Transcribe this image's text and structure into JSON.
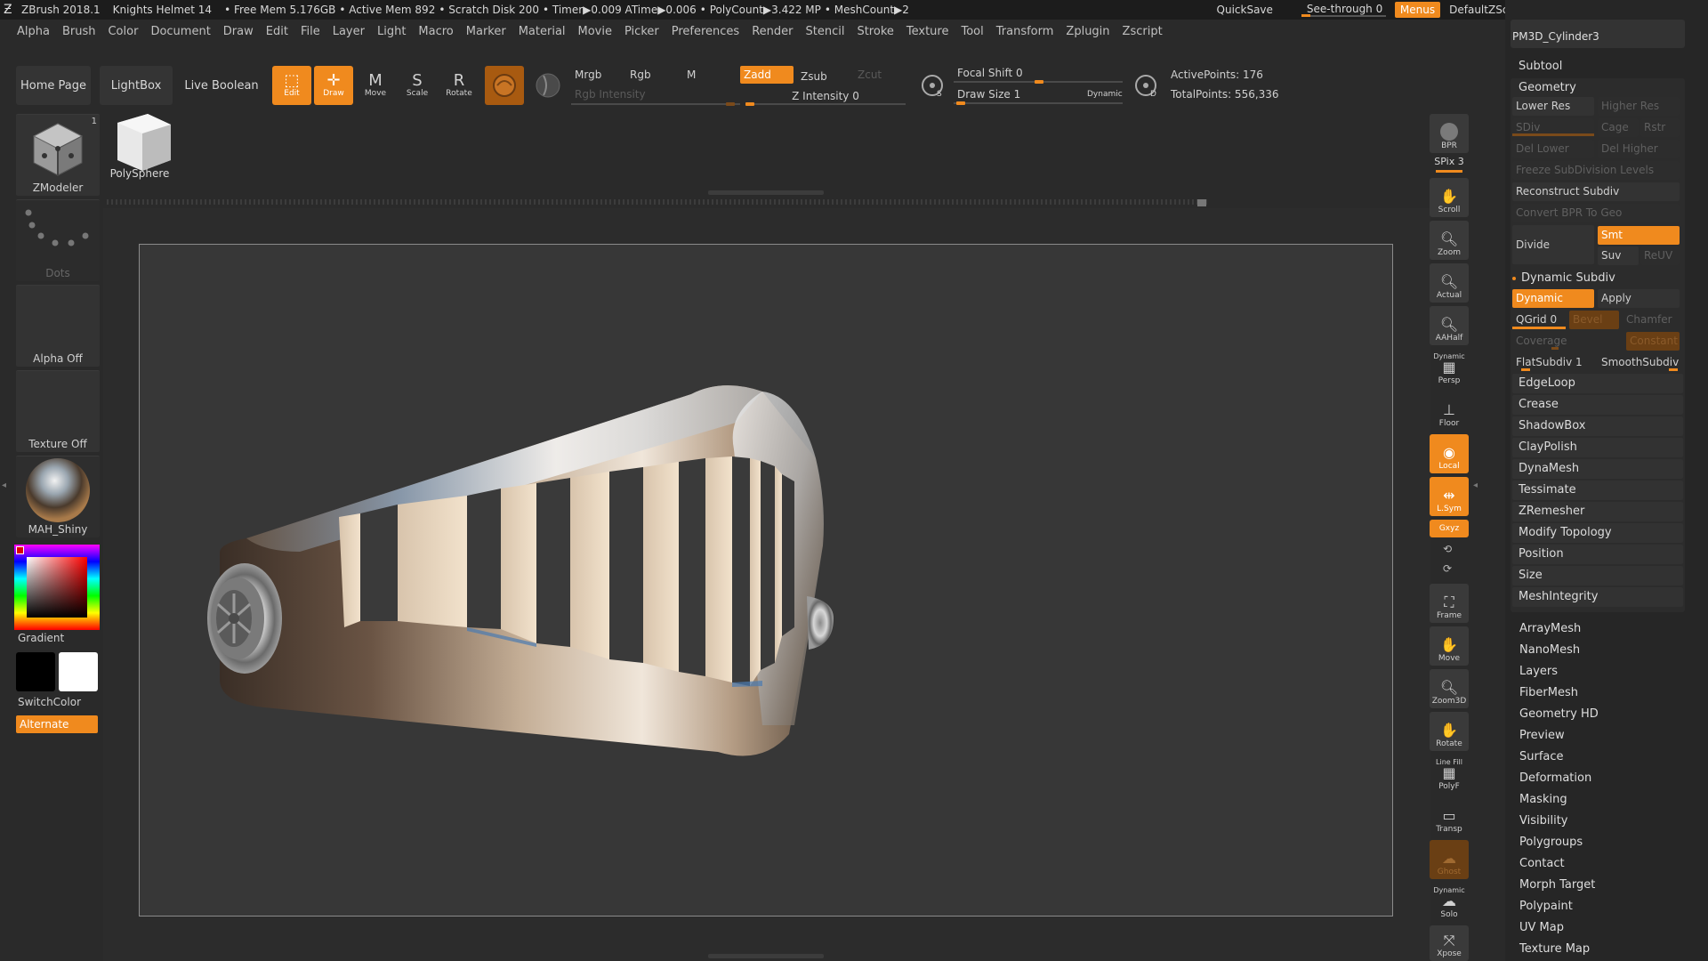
{
  "titlebar": {
    "app": "ZBrush 2018.1",
    "project": "Knights Helmet 14",
    "free_mem": "• Free Mem 5.176GB",
    "active_mem": "• Active Mem 892",
    "scratch": "• Scratch Disk 200",
    "timer": "• Timer▶0.009 ATime▶0.006",
    "polycount": "• PolyCount▶3.422 MP",
    "meshcount": "• MeshCount▶2",
    "quicksave": "QuickSave",
    "see_through": "See-through  0",
    "menus": "Menus",
    "script": "DefaultZScript"
  },
  "menubar": [
    "Alpha",
    "Brush",
    "Color",
    "Document",
    "Draw",
    "Edit",
    "File",
    "Layer",
    "Light",
    "Macro",
    "Marker",
    "Material",
    "Movie",
    "Picker",
    "Preferences",
    "Render",
    "Stencil",
    "Stroke",
    "Texture",
    "Tool",
    "Transform",
    "Zplugin",
    "Zscript"
  ],
  "toolbar": {
    "home_page": "Home Page",
    "lightbox": "LightBox",
    "live_boolean": "Live Boolean",
    "edit": "Edit",
    "draw": "Draw",
    "move": "Move",
    "scale": "Scale",
    "rotate": "Rotate",
    "mrgb": "Mrgb",
    "rgb": "Rgb",
    "m": "M",
    "zadd": "Zadd",
    "zsub": "Zsub",
    "zcut": "Zcut",
    "rgb_intensity": "Rgb Intensity",
    "z_intensity": "Z Intensity 0",
    "focal_shift": "Focal Shift 0",
    "draw_size": "Draw Size 1",
    "dynamic": "Dynamic",
    "active_points": "ActivePoints: 176",
    "total_points": "TotalPoints: 556,336"
  },
  "left_panel": {
    "brush": "ZModeler",
    "brush_count": "1",
    "tool2": "PolySphere",
    "stroke": "Dots",
    "alpha": "Alpha Off",
    "texture": "Texture Off",
    "material": "MAH_Shiny",
    "gradient": "Gradient",
    "switch_color": "SwitchColor",
    "alternate": "Alternate"
  },
  "right_shelf": {
    "bpr": "BPR",
    "spix": "SPix 3",
    "scroll": "Scroll",
    "zoom": "Zoom",
    "actual": "Actual",
    "aahalf": "AAHalf",
    "persp_top": "Dynamic",
    "persp": "Persp",
    "floor": "Floor",
    "local": "Local",
    "lsym": "L.Sym",
    "xyz": "Gxyz",
    "frame": "Frame",
    "move": "Move",
    "zoom3d": "Zoom3D",
    "rotate": "Rotate",
    "polyf_top": "Line Fill",
    "polyf": "PolyF",
    "transp": "Transp",
    "ghost": "Ghost",
    "solo_top": "Dynamic",
    "solo": "Solo",
    "xpose": "Xpose"
  },
  "right_panel": {
    "tool_name": "PM3D_Cylinder3",
    "subtool": "Subtool",
    "geometry": "Geometry",
    "lower_res": "Lower Res",
    "higher_res": "Higher Res",
    "sdiv": "SDiv",
    "cage": "Cage",
    "rstr": "Rstr",
    "del_lower": "Del Lower",
    "del_higher": "Del Higher",
    "freeze": "Freeze SubDivision Levels",
    "reconstruct": "Reconstruct Subdiv",
    "convert_bpr": "Convert BPR To Geo",
    "divide": "Divide",
    "smt": "Smt",
    "suv": "Suv",
    "reuv": "ReUV",
    "dynamic_subdiv": "Dynamic Subdiv",
    "dynamic": "Dynamic",
    "apply": "Apply",
    "qgrid": "QGrid 0",
    "bevel": "Bevel",
    "chamfer": "Chamfer",
    "coverage": "Coverage",
    "constant": "Constant",
    "flat_subdiv": "FlatSubdiv 1",
    "smooth_subdiv": "SmoothSubdiv",
    "geo_items": [
      "EdgeLoop",
      "Crease",
      "ShadowBox",
      "ClayPolish",
      "DynaMesh",
      "Tessimate",
      "ZRemesher",
      "Modify Topology",
      "Position",
      "Size",
      "MeshIntegrity"
    ],
    "tool_items": [
      "ArrayMesh",
      "NanoMesh",
      "Layers",
      "FiberMesh",
      "Geometry HD",
      "Preview",
      "Surface",
      "Deformation",
      "Masking",
      "Visibility",
      "Polygroups",
      "Contact",
      "Morph Target",
      "Polypaint",
      "UV Map",
      "Texture Map"
    ]
  },
  "colors": {
    "accent": "#f08a1e",
    "background": "#2a2a2a",
    "canvas": "#373737"
  }
}
